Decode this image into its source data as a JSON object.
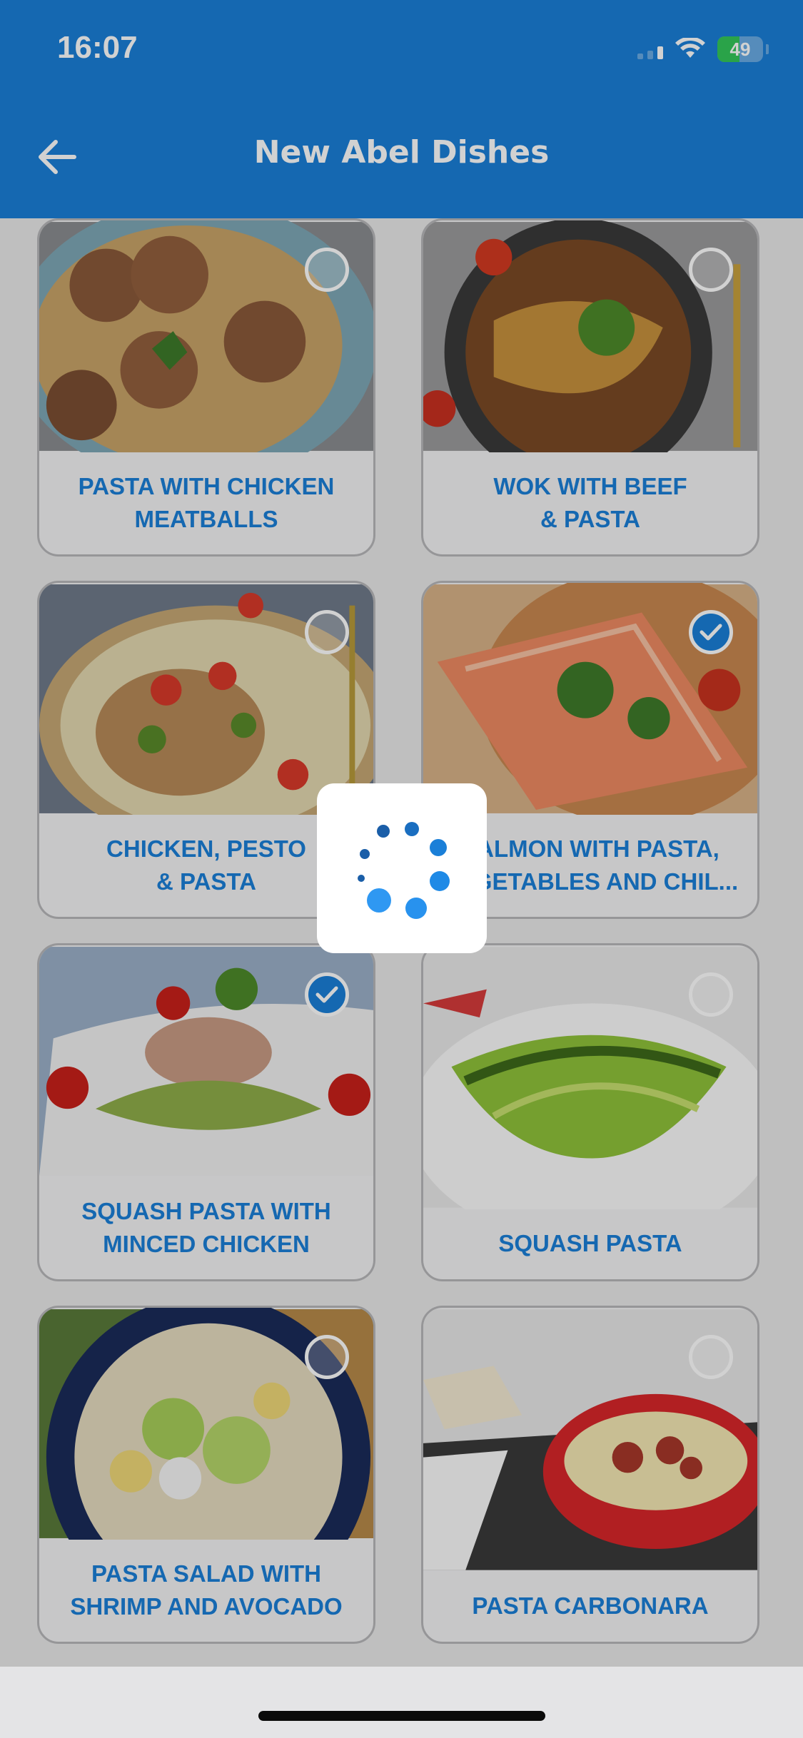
{
  "status_bar": {
    "time": "16:07",
    "battery": "49"
  },
  "nav": {
    "title": "New Abel Dishes",
    "back_icon": "arrow-left-icon"
  },
  "colors": {
    "brand": "#1a7fd8",
    "check_ok": "#34c759"
  },
  "dishes": [
    {
      "label": "PASTA WITH CHICKEN\nMEATBALLS",
      "selected": false
    },
    {
      "label": "WOK WITH BEEF\n& PASTA",
      "selected": false
    },
    {
      "label": "CHICKEN, PESTO\n& PASTA",
      "selected": false
    },
    {
      "label": "SALMON WITH PASTA,\nVEGETABLES AND CHIL...",
      "selected": true
    },
    {
      "label": "SQUASH PASTA WITH\nMINCED CHICKEN",
      "selected": true
    },
    {
      "label": "SQUASH PASTA",
      "selected": false
    },
    {
      "label": "PASTA SALAD WITH\nSHRIMP AND AVOCADO",
      "selected": false
    },
    {
      "label": "PASTA CARBONARA",
      "selected": false
    }
  ],
  "loading": {
    "visible": true,
    "icon": "spinner-icon"
  }
}
